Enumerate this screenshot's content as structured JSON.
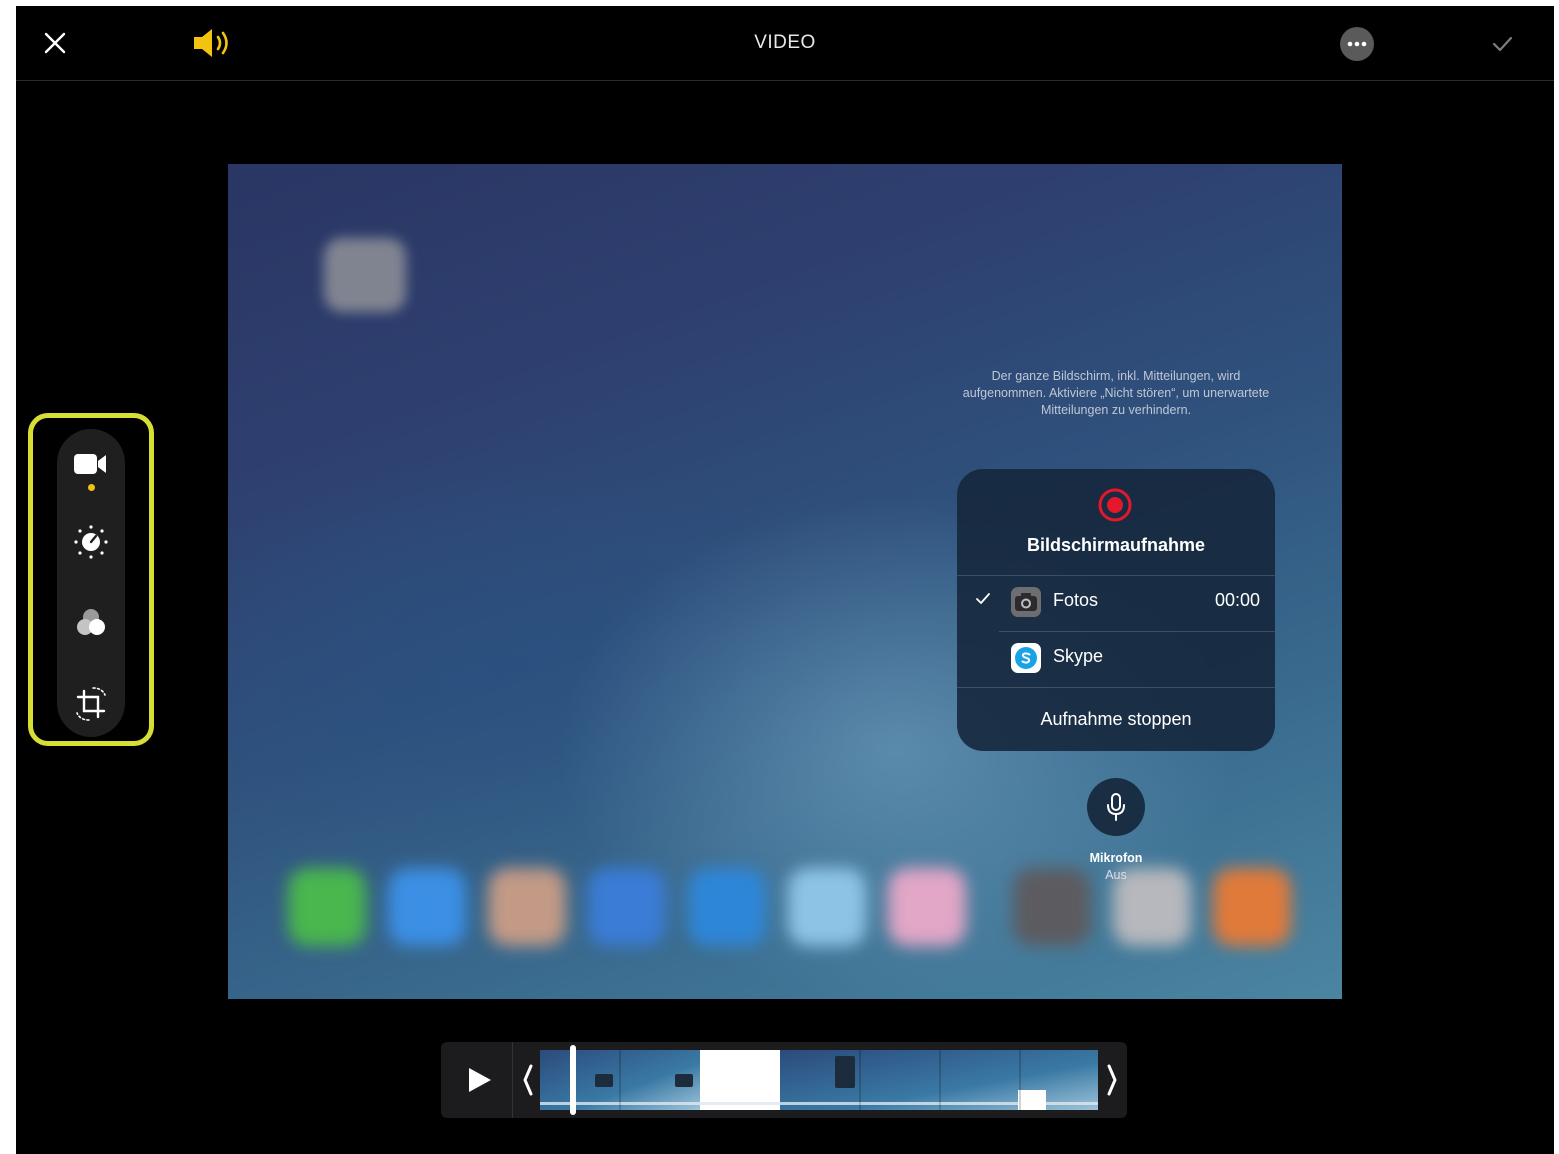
{
  "header": {
    "title": "VIDEO",
    "close_icon": "close-icon",
    "sound_icon": "speaker-on-icon",
    "more_icon": "more-icon",
    "done_icon": "checkmark-icon"
  },
  "toolbar": {
    "tools": [
      {
        "name": "video",
        "icon": "video-camera-icon",
        "selected": true
      },
      {
        "name": "adjust",
        "icon": "adjust-dial-icon"
      },
      {
        "name": "filters",
        "icon": "filters-icon"
      },
      {
        "name": "crop",
        "icon": "crop-rotate-icon"
      }
    ],
    "highlight_color": "#d8df33",
    "selected_indicator_color": "#f1c40f"
  },
  "preview": {
    "note": "Der ganze Bildschirm, inkl. Mitteilungen, wird aufgenommen. Aktiviere „Nicht stören“, um unerwartete Mitteilungen zu verhindern.",
    "panel": {
      "title": "Bildschirmaufnahme",
      "rows": [
        {
          "label": "Fotos",
          "time": "00:00",
          "checked": true,
          "icon": "camera-app-icon"
        },
        {
          "label": "Skype",
          "icon": "skype-app-icon"
        }
      ],
      "stop_label": "Aufnahme stoppen"
    },
    "mic": {
      "label": "Mikrofon",
      "status": "Aus"
    }
  },
  "timeline": {
    "play_icon": "play-icon",
    "trim_left_icon": "trim-handle-left-icon",
    "trim_right_icon": "trim-handle-right-icon"
  },
  "colors": {
    "accent_yellow": "#f1c40f",
    "record_red": "#e5172b",
    "background": "#000000"
  }
}
